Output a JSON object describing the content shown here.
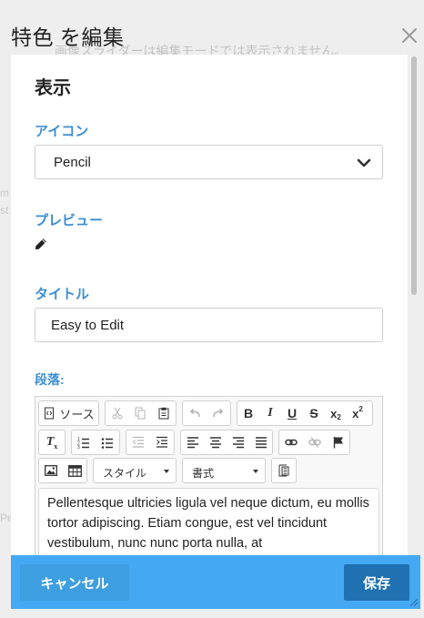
{
  "modal": {
    "title": "特色 を編集",
    "background_notice": "画像スライダーは編集モードでは表示されません。"
  },
  "form": {
    "section_heading": "表示",
    "icon_label": "アイコン",
    "icon_value": "Pencil",
    "preview_label": "プレビュー",
    "preview_icon": "pencil-icon",
    "title_label": "タイトル",
    "title_value": "Easy to Edit",
    "paragraph_label": "段落:"
  },
  "editor": {
    "toolbar": {
      "source_label": "ソース",
      "style_label": "スタイル",
      "format_label": "書式"
    },
    "content": "Pellentesque ultricies ligula vel neque dictum, eu mollis tortor adipiscing. Etiam congue, est vel tincidunt vestibulum, nunc nunc porta nulla, at"
  },
  "footer": {
    "cancel_label": "キャンセル",
    "save_label": "保存"
  },
  "colors": {
    "label_blue": "#3b8fd0",
    "footer_bg": "#44a9f2",
    "save_bg": "#1f71b1"
  }
}
